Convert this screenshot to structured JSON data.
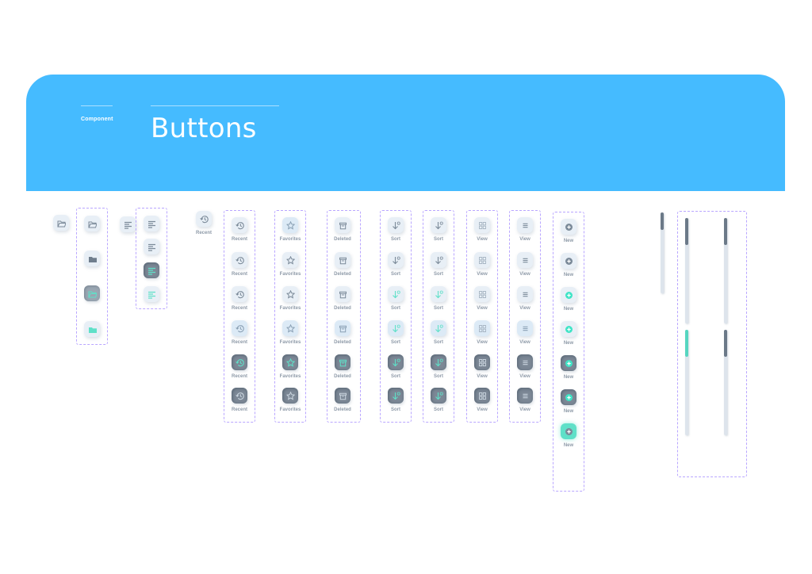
{
  "header": {
    "eyebrow": "Component",
    "title": "Buttons"
  },
  "labels": {
    "recent": "Recent",
    "favorites": "Favorites",
    "deleted": "Deleted",
    "sort": "Sort",
    "view": "View",
    "new": "New"
  },
  "icons": {
    "folder": "folder-icon",
    "folder_open": "folder-open-icon",
    "align": "align-left-icon",
    "history": "history-icon",
    "star": "star-icon",
    "trash": "trash-icon",
    "sort": "sort-down-icon",
    "grid": "grid-view-icon",
    "list": "list-view-icon",
    "plus": "plus-circle-icon"
  },
  "colors": {
    "banner": "#45bbff",
    "accent": "#5fe0c8",
    "dash": "#b9a6ff",
    "label": "#8e9aa8"
  },
  "scrollbars": [
    {
      "state": "default",
      "position": 0.0
    },
    {
      "state": "default",
      "position": 0.0
    },
    {
      "state": "default",
      "position": 0.0
    },
    {
      "state": "active",
      "position": 0.0
    },
    {
      "state": "default",
      "position": 0.0
    }
  ]
}
